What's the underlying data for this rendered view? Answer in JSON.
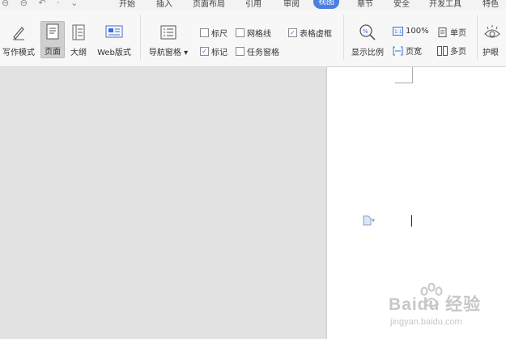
{
  "menu": {
    "quick_access": "⊖ ⊖ ↶ · ⌄",
    "tabs": [
      "开始",
      "插入",
      "页面布局",
      "引用",
      "审阅",
      "视图",
      "章节",
      "安全",
      "开发工具",
      "特色"
    ],
    "active_tab": "视图"
  },
  "ribbon": {
    "views": {
      "write_mode": "写作模式",
      "page": "页面",
      "outline": "大纲",
      "web": "Web版式"
    },
    "nav_pane": "导航窗格",
    "checks": {
      "ruler": {
        "label": "标尺",
        "checked": false
      },
      "gridlines": {
        "label": "网格线",
        "checked": false
      },
      "table_frame": {
        "label": "表格虚框",
        "checked": true
      },
      "marks": {
        "label": "标记",
        "checked": true
      },
      "task_pane": {
        "label": "任务窗格",
        "checked": false
      }
    },
    "zoom": {
      "label": "显示比例",
      "hundred": "100%",
      "page_width": "页宽",
      "single_page": "单页",
      "multi_page": "多页"
    },
    "eye_care": "护眼"
  },
  "watermark": {
    "brand": "Baidu 经验",
    "url": "jingyan.baidu.com"
  },
  "colors": {
    "accent": "#4a7fe0",
    "workspace": "#e2e2e2",
    "page": "#ffffff"
  }
}
